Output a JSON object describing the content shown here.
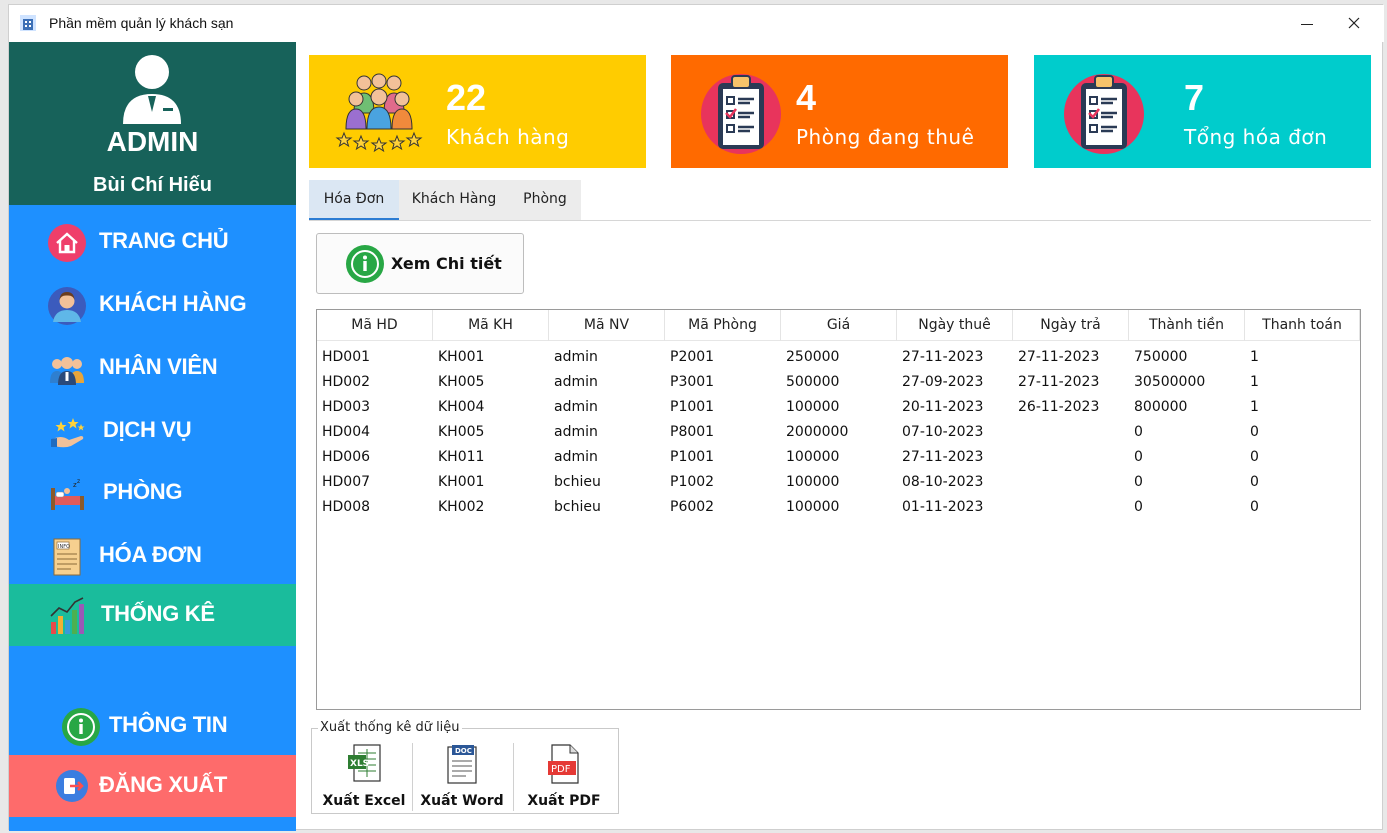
{
  "window": {
    "title": "Phần mềm quản lý khách sạn"
  },
  "sidebar": {
    "role": "ADMIN",
    "user_name": "Bùi Chí Hiếu",
    "items": [
      {
        "label": "TRANG CHỦ",
        "icon": "home-icon"
      },
      {
        "label": "KHÁCH HÀNG",
        "icon": "customer-icon"
      },
      {
        "label": "NHÂN VIÊN",
        "icon": "staff-icon"
      },
      {
        "label": "DỊCH VỤ",
        "icon": "service-icon"
      },
      {
        "label": "PHÒNG",
        "icon": "room-bed-icon"
      },
      {
        "label": "HÓA ĐƠN",
        "icon": "invoice-icon"
      },
      {
        "label": "THỐNG KÊ",
        "icon": "statistics-chart-icon",
        "active": true
      },
      {
        "label": "THÔNG TIN",
        "icon": "info-icon"
      },
      {
        "label": "ĐĂNG XUẤT",
        "icon": "logout-icon"
      }
    ]
  },
  "stats": [
    {
      "value": "22",
      "label": "Khách hàng",
      "color": "#ffcc00"
    },
    {
      "value": "4",
      "label": "Phòng đang thuê",
      "color": "#ff6a00"
    },
    {
      "value": "7",
      "label": "Tổng hóa đơn",
      "color": "#00cccc"
    }
  ],
  "tabs": [
    {
      "label": "Hóa Đơn",
      "active": true
    },
    {
      "label": "Khách Hàng"
    },
    {
      "label": "Phòng"
    }
  ],
  "detail_button": {
    "label": "Xem Chi tiết"
  },
  "table": {
    "columns": [
      "Mã HD",
      "Mã KH",
      "Mã NV",
      "Mã Phòng",
      "Giá",
      "Ngày thuê",
      "Ngày trả",
      "Thành tiền",
      "Thanh toán"
    ],
    "rows": [
      [
        "HD001",
        "KH001",
        "admin",
        "P2001",
        "250000",
        "27-11-2023",
        "27-11-2023",
        "750000",
        "1"
      ],
      [
        "HD002",
        "KH005",
        "admin",
        "P3001",
        "500000",
        "27-09-2023",
        "27-11-2023",
        "30500000",
        "1"
      ],
      [
        "HD003",
        "KH004",
        "admin",
        "P1001",
        "100000",
        "20-11-2023",
        "26-11-2023",
        "800000",
        "1"
      ],
      [
        "HD004",
        "KH005",
        "admin",
        "P8001",
        "2000000",
        "07-10-2023",
        "",
        "0",
        "0"
      ],
      [
        "HD006",
        "KH011",
        "admin",
        "P1001",
        "100000",
        "27-11-2023",
        "",
        "0",
        "0"
      ],
      [
        "HD007",
        "KH001",
        "bchieu",
        "P1002",
        "100000",
        "08-10-2023",
        "",
        "0",
        "0"
      ],
      [
        "HD008",
        "KH002",
        "bchieu",
        "P6002",
        "100000",
        "01-11-2023",
        "",
        "0",
        "0"
      ]
    ]
  },
  "export": {
    "legend": "Xuất thống kê dữ liệu",
    "buttons": [
      {
        "label": "Xuất Excel",
        "icon": "excel-file-icon"
      },
      {
        "label": "Xuất Word",
        "icon": "word-file-icon"
      },
      {
        "label": "Xuất PDF",
        "icon": "pdf-file-icon"
      }
    ]
  }
}
